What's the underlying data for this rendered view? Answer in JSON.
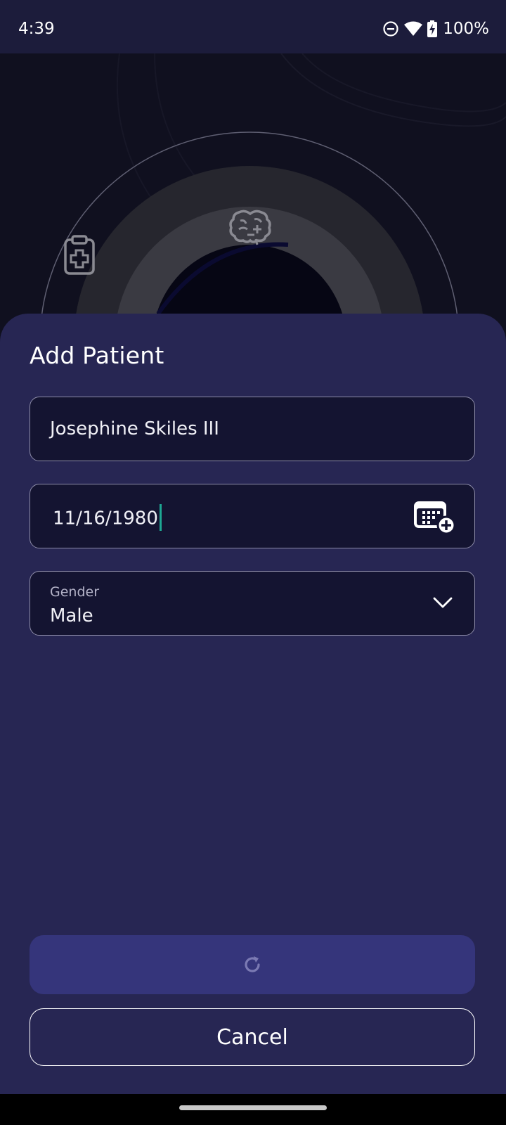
{
  "status_bar": {
    "time": "4:39",
    "battery_text": "100%"
  },
  "hero": {
    "icons": [
      "clipboard-plus-icon",
      "brain-icon"
    ]
  },
  "sheet": {
    "title": "Add Patient",
    "name_field": {
      "value": "Josephine Skiles III"
    },
    "dob_field": {
      "value": "11/16/1980"
    },
    "gender_field": {
      "label": "Gender",
      "value": "Male"
    },
    "primary_button": {
      "icon": "refresh-icon"
    },
    "cancel_button": {
      "label": "Cancel"
    }
  },
  "colors": {
    "sheet_bg": "#272653",
    "field_bg": "#141431",
    "primary_button_bg": "#35357b",
    "caret": "#1ea793"
  }
}
